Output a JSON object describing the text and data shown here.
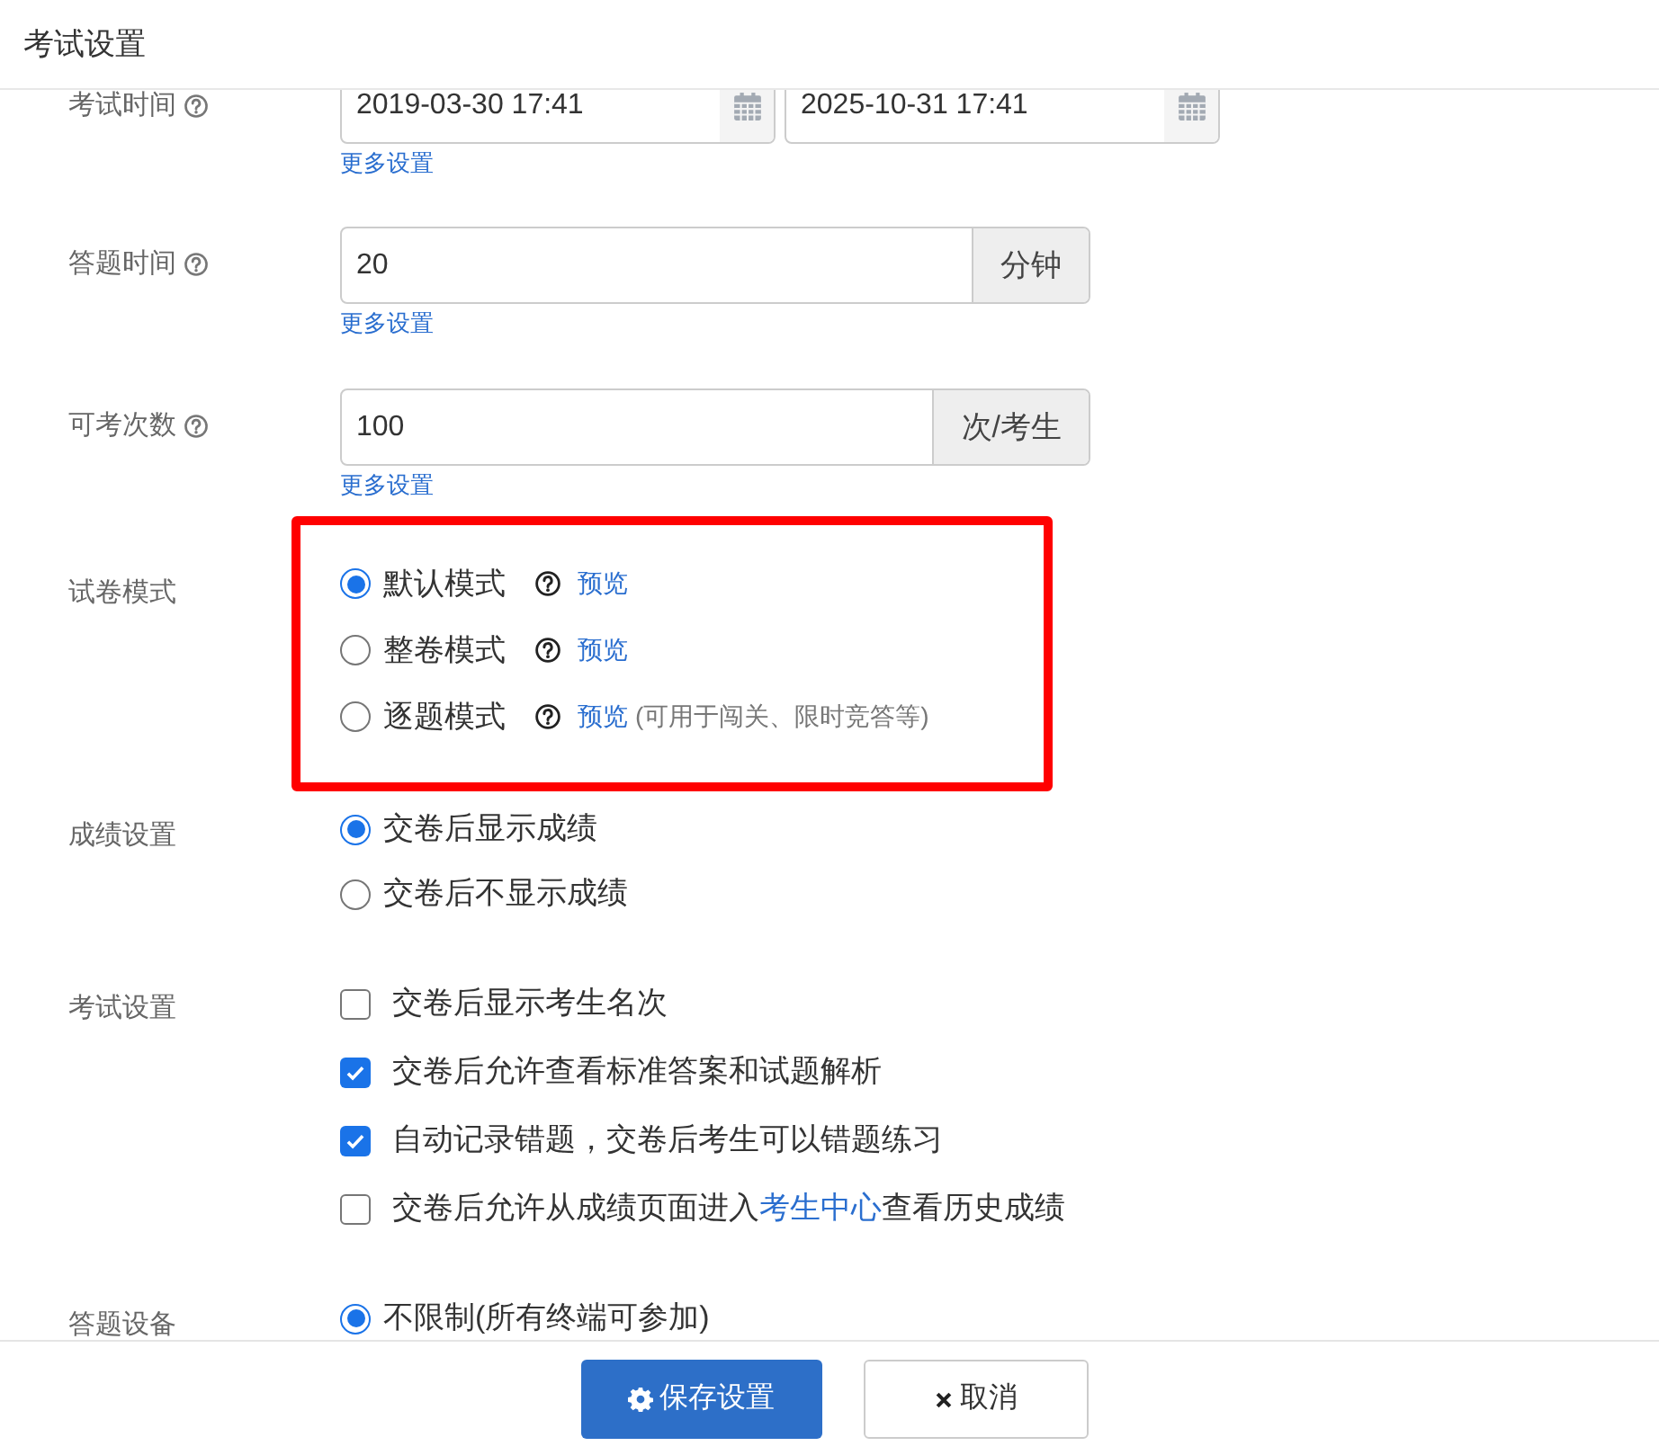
{
  "title": "考试设置",
  "rows": [
    {
      "kind": "date_range",
      "label": "考试时间",
      "help_icon": true,
      "values": [
        "2019-03-30 17:41",
        "2025-10-31 17:41"
      ],
      "link": "更多设置"
    },
    {
      "kind": "input_addon",
      "label": "答题时间",
      "help_icon": true,
      "value": "20",
      "addon": "分钟",
      "link": "更多设置"
    },
    {
      "kind": "input_addon",
      "label": "可考次数",
      "help_icon": true,
      "value": "100",
      "addon": "次/考生",
      "link": "更多设置"
    },
    {
      "kind": "radio",
      "label": "试卷模式",
      "highlighted": true,
      "options": [
        {
          "label": "默认模式",
          "selected": true,
          "help_icon": true,
          "link": "预览"
        },
        {
          "label": "整卷模式",
          "selected": false,
          "help_icon": true,
          "link": "预览"
        },
        {
          "label": "逐题模式",
          "selected": false,
          "help_icon": true,
          "link": "预览",
          "note": "(可用于闯关、限时竞答等)"
        }
      ]
    },
    {
      "kind": "radio",
      "label": "成绩设置",
      "highlighted": false,
      "options": [
        {
          "label": "交卷后显示成绩",
          "selected": true
        },
        {
          "label": "交卷后不显示成绩",
          "selected": false
        }
      ]
    },
    {
      "kind": "checkbox",
      "label": "考试设置",
      "options": [
        {
          "label": "交卷后显示考生名次",
          "checked": false
        },
        {
          "label": "交卷后允许查看标准答案和试题解析",
          "checked": true
        },
        {
          "label": "自动记录错题，交卷后考生可以错题练习",
          "checked": true
        },
        {
          "label": "交卷后允许从成绩页面进入",
          "link": "考生中心",
          "after": "查看历史成绩",
          "checked": false
        }
      ]
    },
    {
      "kind": "radio",
      "label": "答题设备",
      "highlighted": false,
      "options": [
        {
          "label": "不限制(所有终端可参加)",
          "selected": true
        }
      ]
    }
  ],
  "buttons": [
    {
      "kind": "primary",
      "label": "保存设置"
    },
    {
      "kind": "cancel",
      "label": "取消"
    }
  ]
}
